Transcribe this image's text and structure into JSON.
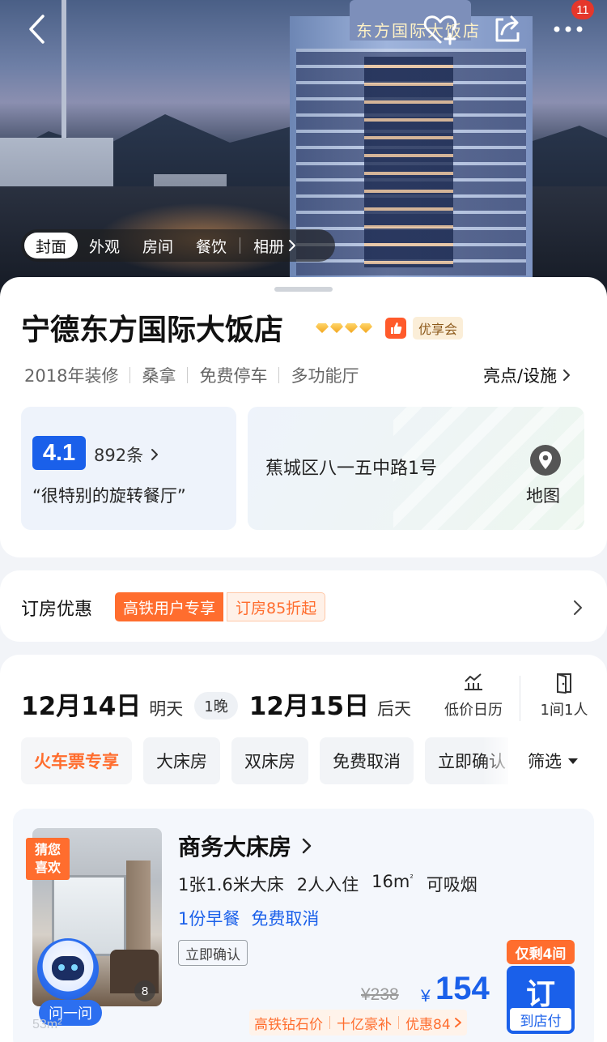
{
  "colors": {
    "brand_blue": "#1a60ea",
    "accent_orange": "#ff6d2e",
    "notification_red": "#e5372b"
  },
  "header": {
    "back_icon": "chevron-left-icon",
    "favorite_icon": "heart-plus-icon",
    "share_icon": "share-icon",
    "more_icon": "more-dots-icon",
    "notification_count": "11",
    "hotel_sign": "东方国际大饭店"
  },
  "photo_tabs": [
    "封面",
    "外观",
    "房间",
    "餐饮",
    "相册"
  ],
  "hotel": {
    "name": "宁德东方国际大饭店",
    "diamond_count": 4,
    "member_tag": "优享会",
    "tags": [
      "2018年装修",
      "桑拿",
      "免费停车",
      "多功能厅"
    ],
    "highlights_link": "亮点/设施",
    "rating": "4.1",
    "review_count": "892条",
    "review_quote": "“很特别的旋转餐厅”",
    "address": "蕉城区八一五中路1号",
    "map_label": "地图"
  },
  "promo": {
    "title": "订房优惠",
    "tag_primary": "高铁用户专享",
    "tag_secondary": "订房85折起"
  },
  "booking": {
    "checkin_date": "12月14日",
    "checkin_day": "明天",
    "nights": "1晚",
    "checkout_date": "12月15日",
    "checkout_day": "后天",
    "calendar_label": "低价日历",
    "rooms_label": "1间1人"
  },
  "filters": [
    "火车票专享",
    "大床房",
    "双床房",
    "免费取消",
    "立即确认"
  ],
  "filter_more": "筛选",
  "room": {
    "badge_line1": "猜您",
    "badge_line2": "喜欢",
    "photo_count": "8",
    "ask_label": "问一问",
    "size_ghost": "53m²",
    "name": "商务大床房",
    "bed": "1张1.6米大床",
    "occupancy": "2人入住",
    "area": "16m",
    "area_unit": "²",
    "smoking": "可吸烟",
    "breakfast": "1份早餐",
    "cancel": "免费取消",
    "confirm_tag": "立即确认",
    "stock_tag": "仅剩4间",
    "price_original": "¥238",
    "currency": "¥",
    "price": "154",
    "book_label": "订",
    "pay_label": "到店付",
    "deal_tags": [
      "高铁钻石价",
      "十亿豪补",
      "优惠84"
    ]
  }
}
